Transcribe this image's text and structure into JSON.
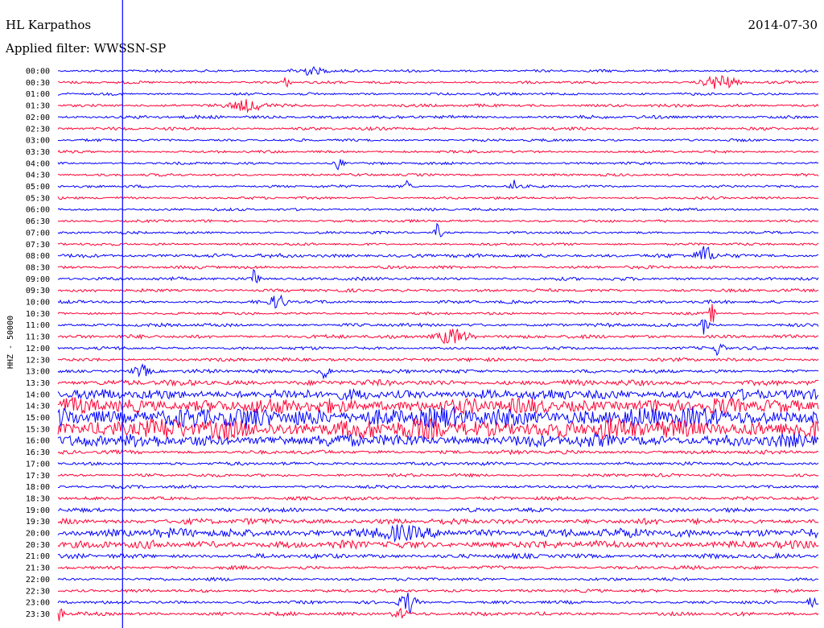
{
  "header": {
    "station": "HL Karpathos",
    "date": "2014-07-30",
    "filter": "Applied filter: WWSSN-SP"
  },
  "colors": {
    "trace_a": "#0000ff",
    "trace_b": "#ff0033",
    "marker": "#0000ff",
    "background": "#ffffff"
  },
  "chart_data": {
    "type": "line",
    "title": "HL Karpathos",
    "ylabel": "HHZ - 50000",
    "row_labels": [
      "00:00",
      "00:30",
      "01:00",
      "01:30",
      "02:00",
      "02:30",
      "03:00",
      "03:30",
      "04:00",
      "04:30",
      "05:00",
      "05:30",
      "06:00",
      "06:30",
      "07:00",
      "07:30",
      "08:00",
      "08:30",
      "09:00",
      "09:30",
      "10:00",
      "10:30",
      "11:00",
      "11:30",
      "12:00",
      "12:30",
      "13:00",
      "13:30",
      "14:00",
      "14:30",
      "15:00",
      "15:30",
      "16:00",
      "16:30",
      "17:00",
      "17:30",
      "18:00",
      "18:30",
      "19:00",
      "19:30",
      "20:00",
      "20:30",
      "21:00",
      "21:30",
      "22:00",
      "22:30",
      "23:00",
      "23:30"
    ],
    "row_colors": [
      "blue",
      "red"
    ],
    "row_noise_level": [
      1,
      1,
      1,
      1.2,
      1.3,
      1.2,
      1,
      1,
      1,
      1,
      1,
      1,
      1,
      1,
      1,
      1,
      1.5,
      1.2,
      1.3,
      1.2,
      1.2,
      1,
      1.3,
      1.4,
      1.2,
      1.3,
      1.4,
      2.2,
      4,
      6,
      8,
      8,
      5,
      1.5,
      1.3,
      1.2,
      1.2,
      1.3,
      1.5,
      2.2,
      3.5,
      3,
      1.8,
      1.4,
      1.2,
      1.2,
      1.2,
      1.4
    ],
    "bursts": [
      {
        "row": 0,
        "t": 0.33,
        "amp": 5,
        "w": 0.02
      },
      {
        "row": 1,
        "t": 0.87,
        "amp": 9,
        "w": 0.02
      },
      {
        "row": 1,
        "t": 0.3,
        "amp": 6,
        "w": 0.005
      },
      {
        "row": 3,
        "t": 0.25,
        "amp": 7,
        "w": 0.02
      },
      {
        "row": 8,
        "t": 0.37,
        "amp": 9,
        "w": 0.005
      },
      {
        "row": 10,
        "t": 0.46,
        "amp": 8,
        "w": 0.004
      },
      {
        "row": 10,
        "t": 0.6,
        "amp": 10,
        "w": 0.004
      },
      {
        "row": 14,
        "t": 0.5,
        "amp": 12,
        "w": 0.004
      },
      {
        "row": 16,
        "t": 0.85,
        "amp": 12,
        "w": 0.01
      },
      {
        "row": 18,
        "t": 0.26,
        "amp": 14,
        "w": 0.005
      },
      {
        "row": 20,
        "t": 0.29,
        "amp": 9,
        "w": 0.01
      },
      {
        "row": 21,
        "t": 0.86,
        "amp": 12,
        "w": 0.004
      },
      {
        "row": 22,
        "t": 0.85,
        "amp": 12,
        "w": 0.005
      },
      {
        "row": 23,
        "t": 0.52,
        "amp": 10,
        "w": 0.02
      },
      {
        "row": 24,
        "t": 0.87,
        "amp": 10,
        "w": 0.006
      },
      {
        "row": 26,
        "t": 0.11,
        "amp": 7,
        "w": 0.01
      },
      {
        "row": 26,
        "t": 0.35,
        "amp": 9,
        "w": 0.006
      },
      {
        "row": 40,
        "t": 0.45,
        "amp": 8,
        "w": 0.02
      },
      {
        "row": 46,
        "t": 0.46,
        "amp": 14,
        "w": 0.01
      },
      {
        "row": 46,
        "t": 0.99,
        "amp": 9,
        "w": 0.006
      },
      {
        "row": 47,
        "t": 0.0,
        "amp": 10,
        "w": 0.006
      },
      {
        "row": 47,
        "t": 0.45,
        "amp": 6,
        "w": 0.01
      }
    ],
    "marker_time_fraction": 0.085,
    "ylim_note": "HHZ counts, clipped"
  }
}
